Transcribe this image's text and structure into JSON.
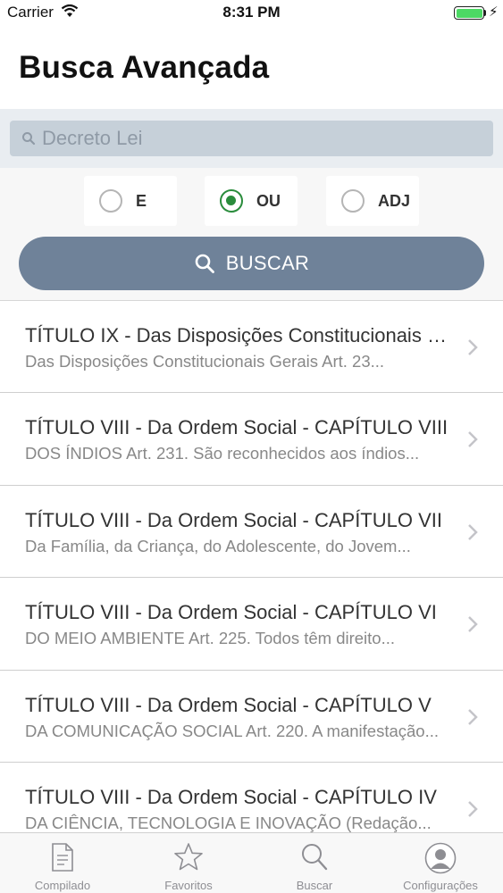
{
  "status_bar": {
    "carrier": "Carrier",
    "time": "8:31 PM",
    "battery_level": 1.0
  },
  "page": {
    "title": "Busca Avançada"
  },
  "search": {
    "placeholder": "Decreto Lei"
  },
  "operators": [
    {
      "label": "E",
      "selected": false
    },
    {
      "label": "OU",
      "selected": true
    },
    {
      "label": "ADJ",
      "selected": false
    }
  ],
  "buscar_button": {
    "label": "BUSCAR"
  },
  "results": [
    {
      "title": "TÍTULO IX - Das Disposições Constitucionais Gerais",
      "subtitle": "Das Disposições Constitucionais Gerais Art. 23..."
    },
    {
      "title": "TÍTULO VIII - Da Ordem Social - CAPÍTULO VIII",
      "subtitle": "DOS ÍNDIOS Art. 231. São reconhecidos aos índios..."
    },
    {
      "title": "TÍTULO VIII - Da Ordem Social - CAPÍTULO VII",
      "subtitle": "Da Família, da Criança, do Adolescente, do Jovem..."
    },
    {
      "title": "TÍTULO VIII - Da Ordem Social - CAPÍTULO VI",
      "subtitle": "DO MEIO AMBIENTE Art. 225. Todos têm direito..."
    },
    {
      "title": "TÍTULO VIII - Da Ordem Social - CAPÍTULO V",
      "subtitle": "DA COMUNICAÇÃO SOCIAL Art. 220. A manifestação..."
    },
    {
      "title": "TÍTULO VIII - Da Ordem Social - CAPÍTULO IV",
      "subtitle": "DA CIÊNCIA, TECNOLOGIA E INOVAÇÃO (Redação..."
    }
  ],
  "tab_bar": {
    "tabs": [
      {
        "label": "Compilado",
        "icon": "document-icon"
      },
      {
        "label": "Favoritos",
        "icon": "star-icon"
      },
      {
        "label": "Buscar",
        "icon": "search-icon"
      },
      {
        "label": "Configurações",
        "icon": "profile-icon"
      }
    ]
  },
  "colors": {
    "accent_green": "#2a8c3c",
    "button_slate": "#6f8299",
    "search_field": "#c6d0d9",
    "battery_green": "#4cd964"
  }
}
